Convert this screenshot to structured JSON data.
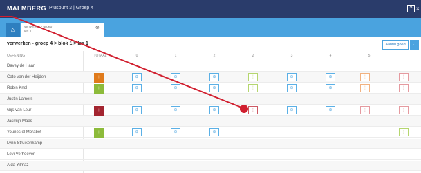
{
  "header": {
    "logo": "MALMBERG",
    "breadcrumb": "Pluspunt 3  |  Groep 4",
    "help_label": "?",
    "close_label": "×"
  },
  "tabbar": {
    "home_label": "⌂",
    "tab_label": "verwerken - groep",
    "tab_sub": "les 1",
    "tab_close": "⊗"
  },
  "page": {
    "title": "verwerken - groep 4 > blok 1 > les 1",
    "aantal_label": "Aantal goed",
    "dropdown_label": "⌄"
  },
  "table": {
    "headers": [
      "OEFENING",
      "TOTAAL",
      "0",
      "1",
      "2",
      "2",
      "3",
      "4",
      "5"
    ],
    "rows": [
      {
        "name": "Davey de Haan"
      },
      {
        "name": "Cato van der Heijden"
      },
      {
        "name": "Robin Knol"
      },
      {
        "name": "Justin Lamers"
      },
      {
        "name": "Gijs van Leur"
      },
      {
        "name": "Jasmijn Maas"
      },
      {
        "name": "Younes el Morabet"
      },
      {
        "name": "Lynn Struikenkamp"
      },
      {
        "name": "Levi Verhoeven"
      },
      {
        "name": "Aida Yilmaz"
      }
    ]
  },
  "colors": {
    "topbar": "#2a3c6b",
    "tabbar": "#4aa3df",
    "annotation": "#d11f2f"
  }
}
